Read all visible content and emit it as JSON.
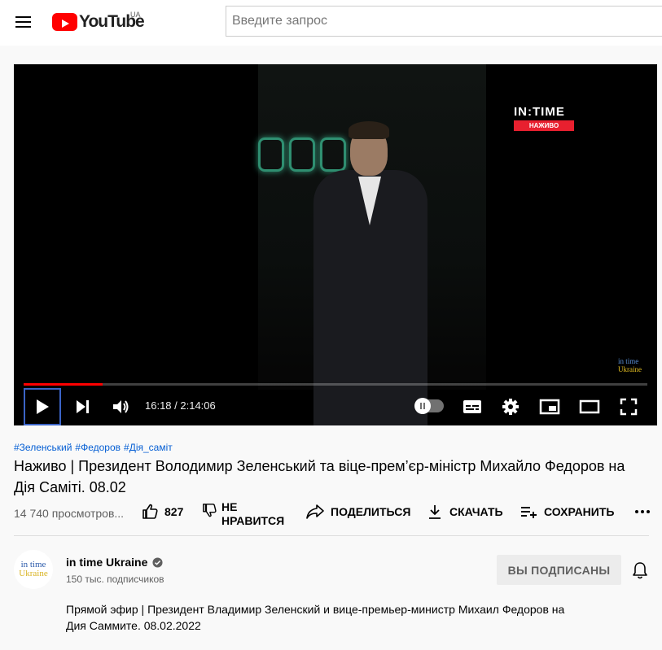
{
  "header": {
    "logo_text": "YouTube",
    "country_code": "UA",
    "search_placeholder": "Введите запрос"
  },
  "player": {
    "time": "16:18 / 2:14:06",
    "progress": 0.126,
    "bug_title": "IN:TIME",
    "bug_badge": "НАЖИВО",
    "watermark_line1": "in time",
    "watermark_line2": "Ukraine"
  },
  "video": {
    "hashtags": [
      "#Зеленський",
      "#Федоров",
      "#Дія_саміт"
    ],
    "title": "Наживо | Президент Володимир Зеленський та віце-прем’єр-міністр Михайло Федоров на Дія Саміті. 08.02",
    "views": "14 740 просмотров...",
    "likes": "827",
    "dislike_label": "НЕ НРАВИТСЯ",
    "share_label": "ПОДЕЛИТЬСЯ",
    "download_label": "СКАЧАТЬ",
    "save_label": "СОХРАНИТЬ"
  },
  "channel": {
    "avatar_line1": "in time",
    "avatar_line2": "Ukraine",
    "name": "in time Ukraine",
    "subscribers": "150 тыс. подписчиков",
    "subscribe_label": "ВЫ ПОДПИСАНЫ",
    "description": "Прямой эфир | Президент Владимир Зеленский и вице-премьер-министр Михаил Федоров на Дия Саммите. 08.02.2022"
  },
  "colors": {
    "accent": "#ff0000",
    "link": "#065fd4",
    "focus": "#3b64c7"
  }
}
